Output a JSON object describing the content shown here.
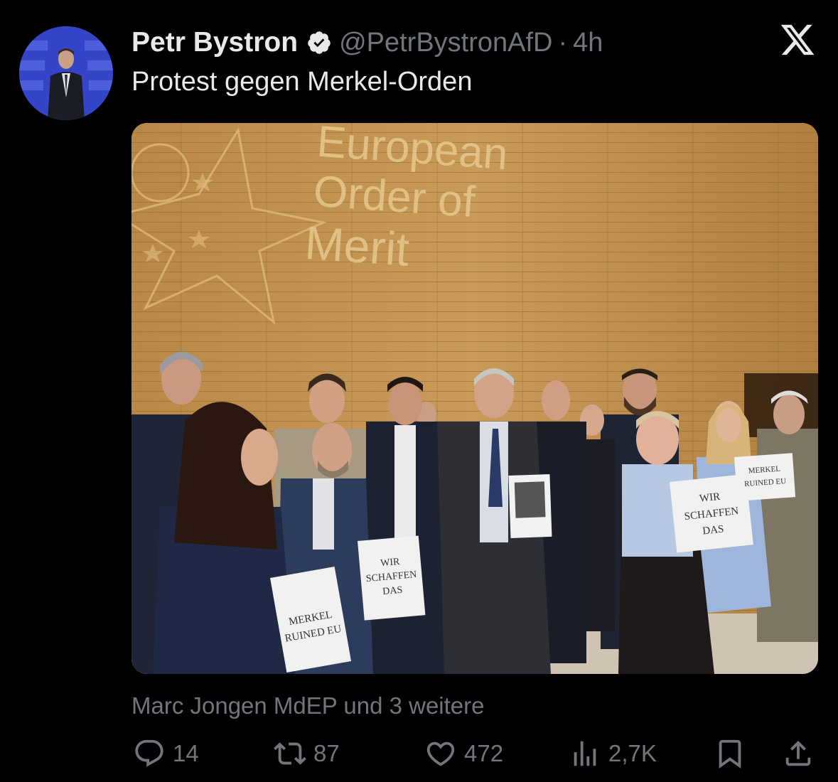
{
  "tweet": {
    "author_name": "Petr Bystron",
    "handle": "@PetrBystronAfD",
    "separator": "·",
    "time": "4h",
    "text": "Protest gegen Merkel-Orden",
    "liked_by": "Marc Jongen MdEP und 3 weitere"
  },
  "media": {
    "wall_lines": [
      "European",
      "Order of",
      "Merit"
    ],
    "signs": {
      "merkel_left": [
        "MERKEL",
        "RUINED EU"
      ],
      "wir_center": [
        "WIR",
        "SCHAFFEN",
        "DAS"
      ],
      "wir_right": [
        "WIR",
        "SCHAFFEN",
        "DAS"
      ],
      "merkel_right": [
        "MERKEL",
        "RUINED EU"
      ]
    }
  },
  "actions": {
    "replies": "14",
    "reposts": "87",
    "likes": "472",
    "views": "2,7K"
  },
  "colors": {
    "background": "#000000",
    "text_primary": "#e7e9ea",
    "text_secondary": "#71767b",
    "verified_badge": "#e7e9ea"
  },
  "icons": [
    "verified-badge-icon",
    "x-logo-icon",
    "reply-icon",
    "repost-icon",
    "like-icon",
    "views-icon",
    "bookmark-icon",
    "share-icon"
  ]
}
